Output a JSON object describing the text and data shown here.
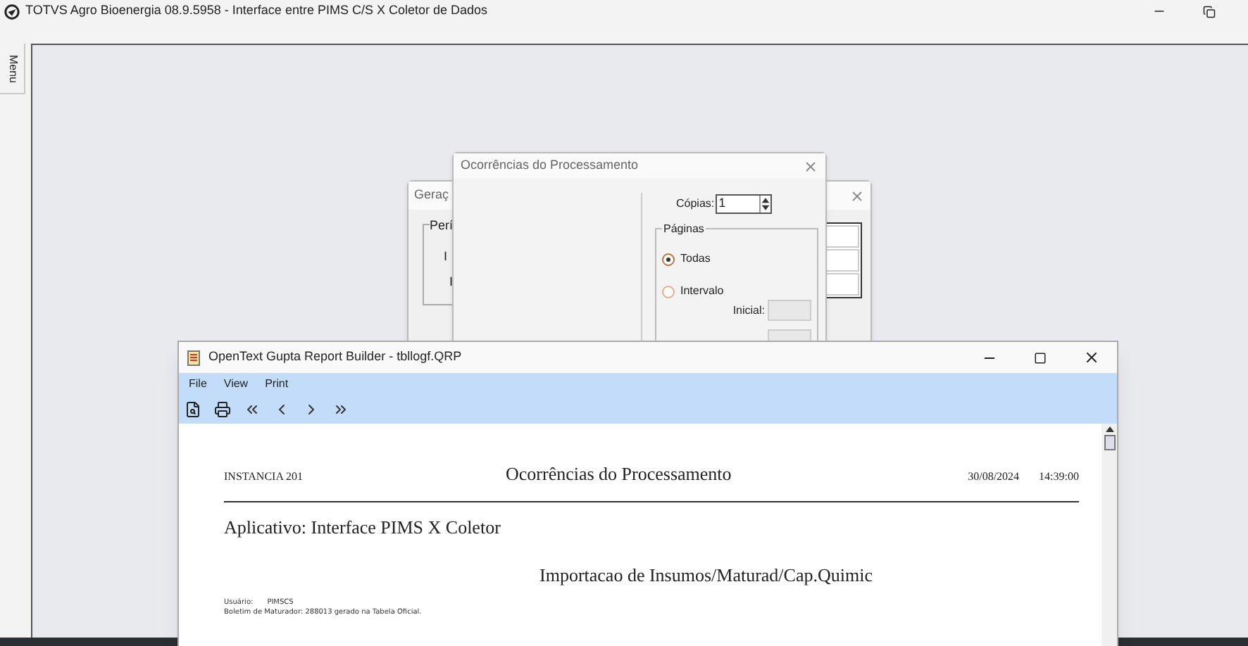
{
  "app": {
    "title": "TOTVS Agro Bioenergia 08.9.5958 - Interface entre PIMS C/S X Coletor de Dados",
    "side_tab": "Menu"
  },
  "back_dialog": {
    "title": "Geraç",
    "group_label": "Perí",
    "labels": [
      "I",
      "I"
    ]
  },
  "print_dialog": {
    "title": "Ocorrências do Processamento",
    "copies_label": "Cópias:",
    "copies_value": "1",
    "pages_label": "Páginas",
    "options": [
      {
        "label": "Todas",
        "selected": true
      },
      {
        "label": "Intervalo",
        "selected": false
      }
    ],
    "range_fields": [
      {
        "label": "Inicial:"
      }
    ]
  },
  "report_window": {
    "title": "OpenText Gupta Report Builder - tbllogf.QRP",
    "menu": [
      "File",
      "View",
      "Print"
    ],
    "report": {
      "instance": "INSTANCIA 201",
      "heading": "Ocorrências do Processamento",
      "date": "30/08/2024",
      "time": "14:39:00",
      "application": "Aplicativo: Interface PIMS X Coletor",
      "subtitle": "Importacao de Insumos/Maturad/Cap.Quimic",
      "user_label": "Usuário:",
      "user": "PIMSCS",
      "message": "Boletim de Maturador: 288013  gerado na Tabela Oficial."
    }
  }
}
